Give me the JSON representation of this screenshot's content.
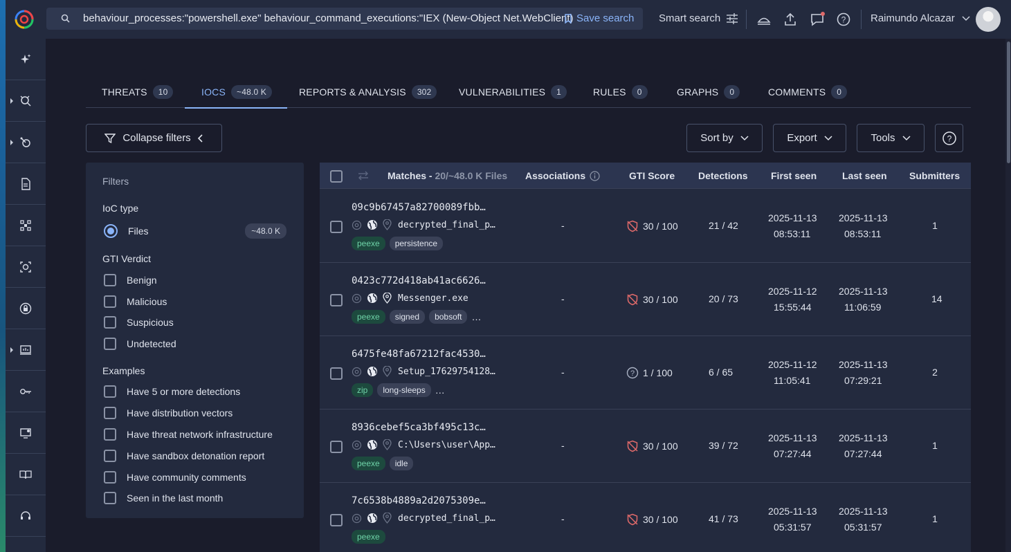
{
  "search": {
    "query": "behaviour_processes:\"powershell.exe\" behaviour_command_executions:\"IEX (New-Object Net.WebClient)",
    "save_label": "Save search"
  },
  "header": {
    "smart_search": "Smart search",
    "user_name": "Raimundo Alcazar"
  },
  "tabs": [
    {
      "label": "THREATS",
      "count": "10"
    },
    {
      "label": "IOCS",
      "count": "~48.0 K"
    },
    {
      "label": "REPORTS & ANALYSIS",
      "count": "302"
    },
    {
      "label": "VULNERABILITIES",
      "count": "1"
    },
    {
      "label": "RULES",
      "count": "0"
    },
    {
      "label": "GRAPHS",
      "count": "0"
    },
    {
      "label": "COMMENTS",
      "count": "0"
    }
  ],
  "toolbar": {
    "collapse_filters": "Collapse filters",
    "sort_by": "Sort by",
    "export": "Export",
    "tools": "Tools"
  },
  "filters": {
    "title": "Filters",
    "ioc_type_heading": "IoC type",
    "files_label": "Files",
    "files_count": "~48.0 K",
    "gti_heading": "GTI Verdict",
    "verdicts": [
      "Benign",
      "Malicious",
      "Suspicious",
      "Undetected"
    ],
    "examples_heading": "Examples",
    "examples": [
      "Have 5 or more detections",
      "Have distribution vectors",
      "Have threat network infrastructure",
      "Have sandbox detonation report",
      "Have community comments",
      "Seen in the last month"
    ]
  },
  "table": {
    "headers": {
      "matches": "Matches -",
      "matches_sub": "20/~48.0 K Files",
      "associations": "Associations",
      "gti_score": "GTI Score",
      "detections": "Detections",
      "first_seen": "First seen",
      "last_seen": "Last seen",
      "submitters": "Submitters"
    },
    "rows": [
      {
        "hash": "09c9b67457a82700089fbb…",
        "filename": "decrypted_final_p…",
        "tags": [
          "peexe",
          "persistence"
        ],
        "more": "",
        "associations": "-",
        "gti": "30 / 100",
        "detections": "21 / 42",
        "first_date": "2025-11-13",
        "first_time": "08:53:11",
        "last_date": "2025-11-13",
        "last_time": "08:53:11",
        "submitters": "1"
      },
      {
        "hash": "0423c772d418ab41ac6626…",
        "filename": "Messenger.exe",
        "tags": [
          "peexe",
          "signed",
          "bobsoft"
        ],
        "more": "…",
        "associations": "-",
        "gti": "30 / 100",
        "detections": "20 / 73",
        "first_date": "2025-11-12",
        "first_time": "15:55:44",
        "last_date": "2025-11-13",
        "last_time": "11:06:59",
        "submitters": "14"
      },
      {
        "hash": "6475fe48fa67212fac4530…",
        "filename": "Setup_17629754128…",
        "tags": [
          "zip",
          "long-sleeps"
        ],
        "more": "…",
        "associations": "-",
        "gti": "1 / 100",
        "detections": "6 / 65",
        "first_date": "2025-11-12",
        "first_time": "11:05:41",
        "last_date": "2025-11-13",
        "last_time": "07:29:21",
        "submitters": "2"
      },
      {
        "hash": "8936cebef5ca3bf495c13c…",
        "filename": "C:\\Users\\user\\App…",
        "tags": [
          "peexe",
          "idle"
        ],
        "more": "",
        "associations": "-",
        "gti": "30 / 100",
        "detections": "39 / 72",
        "first_date": "2025-11-13",
        "first_time": "07:27:44",
        "last_date": "2025-11-13",
        "last_time": "07:27:44",
        "submitters": "1"
      },
      {
        "hash": "7c6538b4889a2d2075309e…",
        "filename": "decrypted_final_p…",
        "tags": [
          "peexe"
        ],
        "more": "",
        "associations": "-",
        "gti": "30 / 100",
        "detections": "41 / 73",
        "first_date": "2025-11-13",
        "first_time": "05:31:57",
        "last_date": "2025-11-13",
        "last_time": "05:31:57",
        "submitters": "1"
      }
    ]
  },
  "colors": {
    "accent": "#8ab4f8",
    "bg": "#1a1c2b",
    "panel": "#232a3e",
    "tag_green": "#6fd3a8",
    "alert": "#e06a6a"
  }
}
